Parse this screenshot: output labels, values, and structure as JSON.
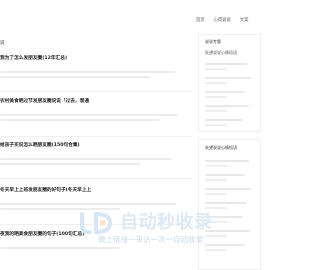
{
  "nav": {
    "items": [
      "首页",
      "心得说说",
      "文案"
    ]
  },
  "main": {
    "section_title": "说",
    "articles": [
      {
        "title": "我为了怎么发朋友圈(12年汇总)"
      },
      {
        "title": "农村美食晒过节发朋友圈说说「过去，普通"
      },
      {
        "title": "给孩子买说怎么晒朋友圈(150句合集)"
      },
      {
        "title": "冬天早上上班发朋友圈的好句子(冬天早上上"
      },
      {
        "title": "夜我的晒美食朋友圈的句子(100句汇总)"
      }
    ]
  },
  "sidebar": {
    "block1_title": "说说专题",
    "block1_subtitle": "失望说说心情短语",
    "block2_title": "失望说说心情短语"
  },
  "watermark": {
    "logo_text": "JD",
    "main": "自动秒收录",
    "sub": "做上链接一来访一次一自动收录"
  }
}
